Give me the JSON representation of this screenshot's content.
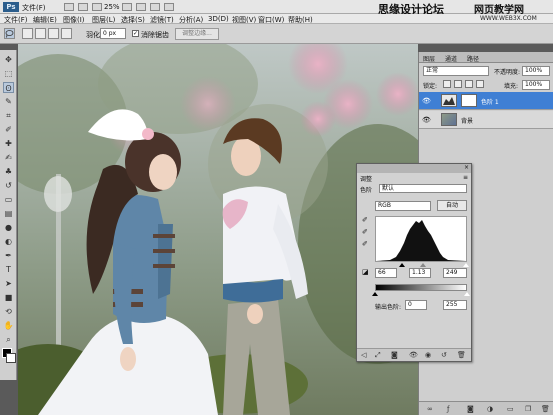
{
  "menubar": {
    "logo": "Ps",
    "items": [
      "文件(F)",
      "编辑(E)",
      "图像(I)",
      "图层(L)",
      "选择(S)",
      "滤镜(T)",
      "分析(A)",
      "3D(D)",
      "视图(V)",
      "窗口(W)",
      "帮助(H)"
    ],
    "zoom": "25%"
  },
  "watermark": {
    "left": "思缘设计论坛",
    "right": "网页教学网",
    "url": "WWW.WEB3X.COM"
  },
  "options": {
    "feather_label": "羽化:",
    "feather_value": "0 px",
    "antialias_label": "消除锯齿",
    "antialias_checked": "✓",
    "refine_edge": "调整边缘..."
  },
  "layers": {
    "tabs": [
      "图层",
      "通道",
      "路径"
    ],
    "blend_mode": "正常",
    "opacity_label": "不透明度:",
    "opacity": "100%",
    "lock_label": "锁定:",
    "fill_label": "填充:",
    "fill": "100%",
    "list": [
      {
        "name": "色阶 1",
        "selected": true
      },
      {
        "name": "背景",
        "selected": false
      }
    ]
  },
  "adjustments": {
    "tab": "调整",
    "panel_name": "色阶",
    "preset": "默认",
    "channel": "RGB",
    "auto": "自动",
    "input_black": "66",
    "input_gamma": "1.13",
    "input_white": "249",
    "output_label": "输出色阶:",
    "output_black": "0",
    "output_white": "255"
  },
  "colors": {
    "layer_selected": "#3f7fd4",
    "panel": "#cfcfcf",
    "menubar": "#e6e6e6"
  },
  "icons": [
    "lasso-icon",
    "move-icon",
    "marquee-icon",
    "crop-icon",
    "eyedropper-icon",
    "brush-icon",
    "eraser-icon",
    "gradient-icon",
    "pen-icon",
    "text-icon",
    "hand-icon",
    "zoom-icon",
    "eye-icon",
    "close-icon",
    "menu-icon"
  ]
}
